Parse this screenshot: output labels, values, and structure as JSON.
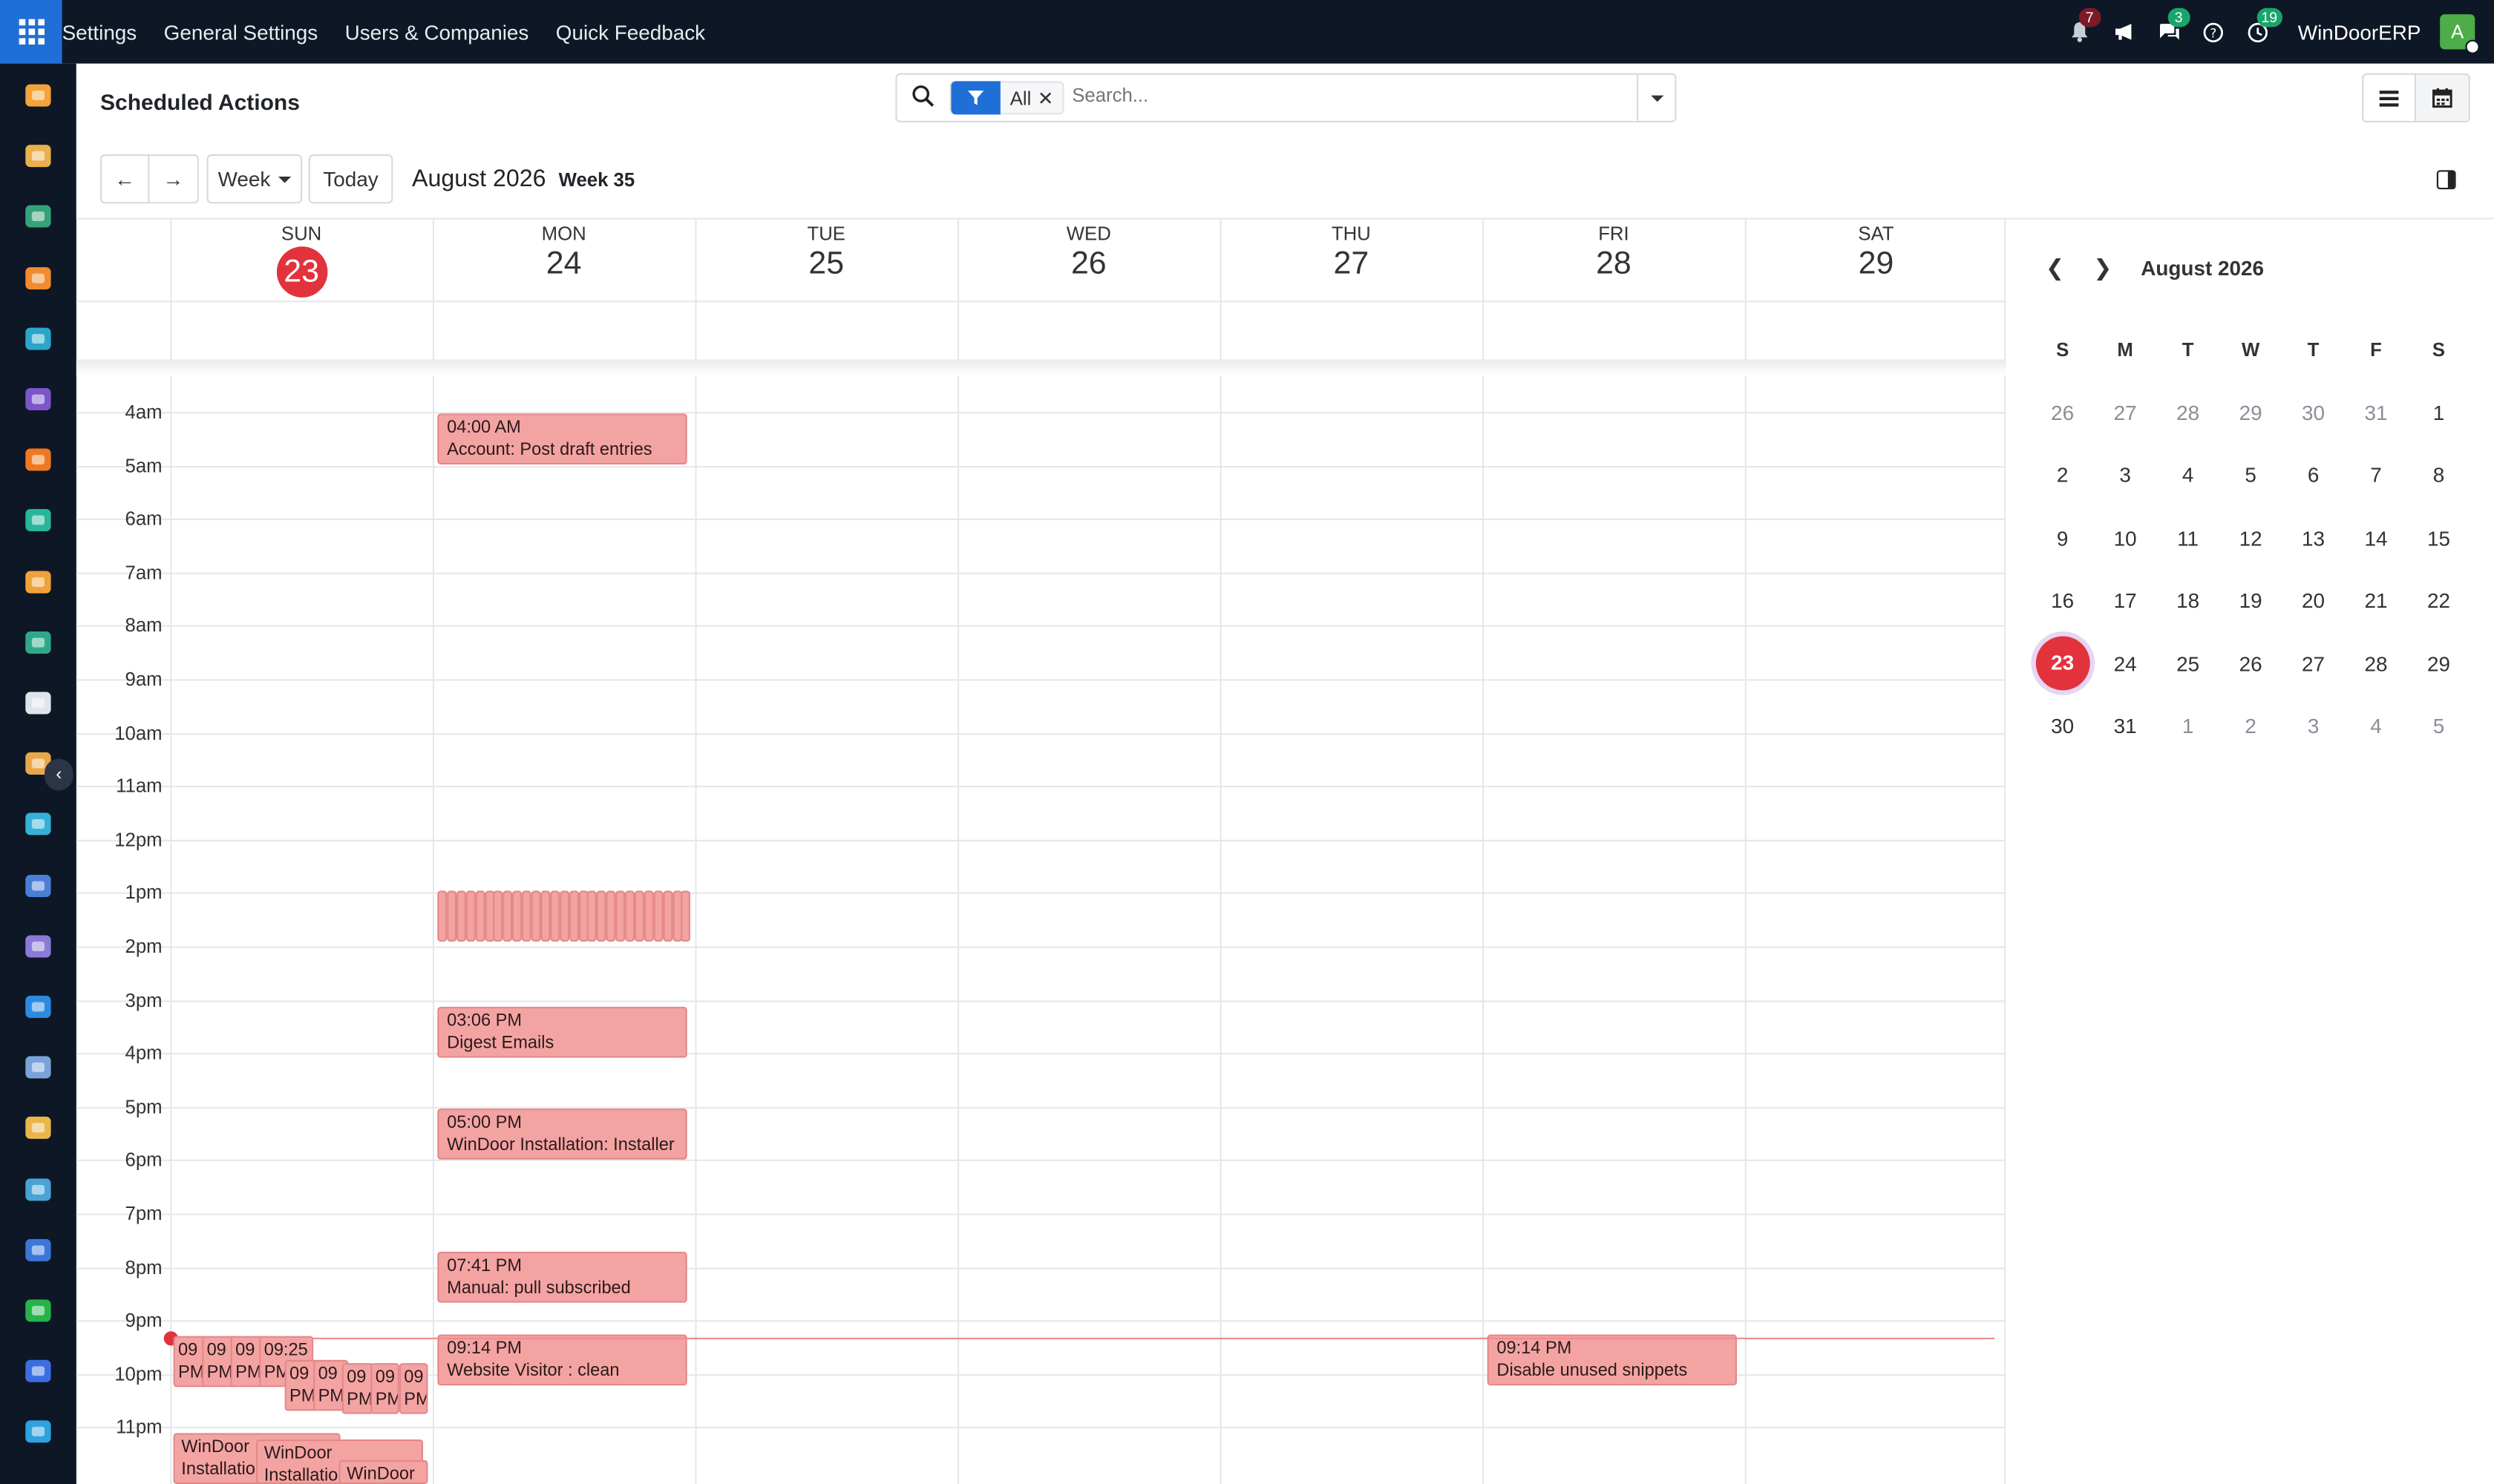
{
  "topbar": {
    "menu": [
      "Settings",
      "General Settings",
      "Users & Companies",
      "Quick Feedback"
    ],
    "badges": {
      "activities": "7",
      "messages": "3",
      "clock": "19"
    },
    "company": "WinDoorERP",
    "avatar_initial": "A"
  },
  "sidebar_icons": [
    "crm-chart-icon",
    "photo-app-icon",
    "contacts-icon",
    "discuss-icon",
    "sign-icon",
    "email-marketing-icon",
    "chat-icon",
    "vendor-icon",
    "dashboard-icon",
    "employees-icon",
    "inventory-icon",
    "planning-icon",
    "project-icon",
    "knowledge-icon",
    "product-icon",
    "invoicing-icon",
    "team-icon",
    "calendar-31-icon",
    "pen-icon",
    "studio-icon",
    "whatsapp-icon",
    "timer-icon",
    "sync-icon"
  ],
  "page": {
    "title": "Scheduled Actions",
    "filter_label": "All",
    "search_placeholder": "Search...",
    "view_label": "Week",
    "today_label": "Today",
    "period": "August 2026",
    "week": "Week 35"
  },
  "days": [
    {
      "name": "SUN",
      "num": "23",
      "today": true
    },
    {
      "name": "MON",
      "num": "24",
      "today": false
    },
    {
      "name": "TUE",
      "num": "25",
      "today": false
    },
    {
      "name": "WED",
      "num": "26",
      "today": false
    },
    {
      "name": "THU",
      "num": "27",
      "today": false
    },
    {
      "name": "FRI",
      "num": "28",
      "today": false
    },
    {
      "name": "SAT",
      "num": "29",
      "today": false
    }
  ],
  "hours": [
    "4am",
    "5am",
    "6am",
    "7am",
    "8am",
    "9am",
    "10am",
    "11am",
    "12pm",
    "1pm",
    "2pm",
    "3pm",
    "4pm",
    "5pm",
    "6pm",
    "7pm",
    "8pm",
    "9pm",
    "10pm",
    "11pm"
  ],
  "events": [
    {
      "day": 1,
      "time": "04:00 AM",
      "title": "Account: Post draft entries"
    },
    {
      "day": 1,
      "time": "03:06 PM",
      "title": "Digest Emails"
    },
    {
      "day": 1,
      "time": "05:00 PM",
      "title": "WinDoor Installation: Installer"
    },
    {
      "day": 1,
      "time": "07:41 PM",
      "title": "Manual: pull subscribed"
    },
    {
      "day": 1,
      "time": "09:14 PM",
      "title": "Website Visitor : clean"
    },
    {
      "day": 5,
      "time": "09:14 PM",
      "title": "Disable unused snippets"
    }
  ],
  "sunday_events": [
    {
      "time": "09",
      "sub": "PM"
    },
    {
      "time": "09",
      "sub": "PM"
    },
    {
      "time": "09",
      "sub": "PM"
    },
    {
      "time": "09:25",
      "sub": "PM"
    },
    {
      "time": "09",
      "sub": "PM"
    },
    {
      "time": "09",
      "sub": "PM"
    },
    {
      "time": "09",
      "sub": "PM"
    },
    {
      "time": "09",
      "sub": "PM"
    },
    {
      "time": "09",
      "sub": "PM"
    }
  ],
  "sunday_late": [
    {
      "title": "WinDoor",
      "sub": "Installatio"
    },
    {
      "title": "WinDoor",
      "sub": "Installatio"
    },
    {
      "title": "WinDoor",
      "sub": ""
    }
  ],
  "mini": {
    "title": "August 2026",
    "dow": [
      "S",
      "M",
      "T",
      "W",
      "T",
      "F",
      "S"
    ],
    "weeks": [
      [
        "26",
        "27",
        "28",
        "29",
        "30",
        "31",
        "1"
      ],
      [
        "2",
        "3",
        "4",
        "5",
        "6",
        "7",
        "8"
      ],
      [
        "9",
        "10",
        "11",
        "12",
        "13",
        "14",
        "15"
      ],
      [
        "16",
        "17",
        "18",
        "19",
        "20",
        "21",
        "22"
      ],
      [
        "23",
        "24",
        "25",
        "26",
        "27",
        "28",
        "29"
      ],
      [
        "30",
        "31",
        "1",
        "2",
        "3",
        "4",
        "5"
      ]
    ],
    "selected": "23"
  },
  "colors": {
    "accent": "#1f6fd6",
    "event": "#f4a3a3",
    "today": "#e2323c",
    "topbar": "#0e1726"
  }
}
